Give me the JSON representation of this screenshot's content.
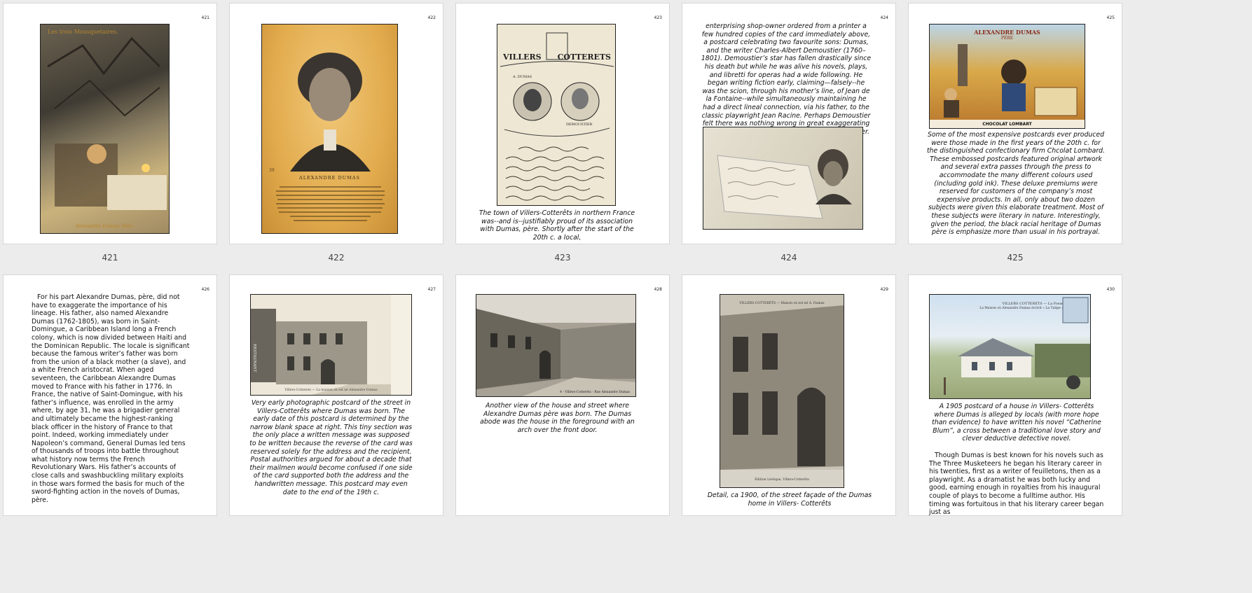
{
  "pages": [
    {
      "num": "421",
      "label": "421",
      "pic": {
        "top_text": "Les trois Mousquetaires.",
        "bottom_text": "Alexandre Dumas Père."
      }
    },
    {
      "num": "422",
      "label": "422",
      "pic": {
        "title": "ALEXANDRE DUMAS",
        "ref": "39"
      }
    },
    {
      "num": "423",
      "label": "423",
      "pic": {
        "title_left": "VILLERS",
        "title_right": "COTTERETS",
        "medallion_left": "A. DUMAS",
        "medallion_right": "DEMOUSTIER"
      },
      "caption": "The town of Villers-Cotterêts in northern France was--and is--justifiably proud of its association with Dumas, père. Shortly after the start of the 20th c. a local,"
    },
    {
      "num": "424",
      "label": "424",
      "body": "enterprising shop-owner ordered from a printer a few hundred copies of the card immediately above, a postcard celebrating two favourite sons: Dumas, and the writer Charles-Albert Demoustier (1760–1801). Demoustier’s star has fallen drastically since his death but while he was alive his novels, plays, and libretti for operas had a wide following. He began writing fiction early, claiming—falsely--he was the scion, through his mother’s line, of Jean de la Fontaine--while simultaneously maintaining he had a direct lineal connection, via his father, to the classic playwright Jean Racine. Perhaps Demoustier felt there was nothing wrong in great exaggerating his claims in this way as he was, after all, a lawyer."
    },
    {
      "num": "425",
      "label": "425",
      "pic": {
        "title": "ALEXANDRE DUMAS",
        "subtitle": "PÈRE",
        "footer": "CHOCOLAT LOMBART"
      },
      "caption": "Some of the most expensive postcards ever produced were those made in the first years of the 20th c. for the distinguished confectionary firm Chcolat Lombard. These embossed postcards featured original artwork and several extra passes through the press to accommodate the many different colours used (including gold ink). These deluxe premiums were reserved for customers of the company’s most expensive products. In all, only about two dozen subjects were given this elaborate treatment. Most of these subjects were literary in nature. Interestingly, given the period, the black racial heritage of Dumas père is emphasize more than usual in his portrayal."
    },
    {
      "num": "426",
      "label": "",
      "body": "For his part Alexandre Dumas, père, did not have to exaggerate the importance of his lineage. His father, also named Alexandre Dumas (1762-1805), was born in Saint-Domingue, a Caribbean Island long a French colony, which is now divided between Haiti and the Dominican Republic. The locale is significant because the famous writer’s father was born from the union of a black mother (a slave), and a white French aristocrat. When aged seventeen, the Caribbean Alexandre Dumas moved to France with his father in 1776. In France, the native of Saint-Domingue, with his father’s influence, was enrolled in the army where, by age 31, he was a brigadier general and ultimately became the highest-ranking black officer in the history of France to that point. Indeed, working immediately under Napoleon’s command, General Dumas led tens of thousands of troops into battle throughout what history now terms the French Revolutionary Wars. His father’s accounts of close calls and swashbuckling military exploits in those wars formed the basis for much of the sword-fighting action in the novels of Dumas, père."
    },
    {
      "num": "427",
      "label": "",
      "pic": {
        "sign": "RESTAURANT",
        "footer": "Villers-Cotterets — La maison où est né Alexandre Dumas"
      },
      "caption": "Very early photographic postcard of the street in Villers-Cotterêts where Dumas was born. The early date of this postcard is determined by the narrow blank space at right. This tiny section was the only place a written message was supposed to be written because the reverse of the card was reserved solely for the address and the recipient. Postal authorities argued for about a decade that their mailmen would become confused if one side of the card supported both the address and the handwritten message. This postcard may even date to the end of the 19th c."
    },
    {
      "num": "428",
      "label": "",
      "pic": {
        "footer": "4 - Villers-Cotterêts - Rue Alexandre Dumas"
      },
      "caption": "Another view of the house and street where Alexandre Dumas père was born. The Dumas abode was the house in the foreground with an arch over the front door."
    },
    {
      "num": "429",
      "label": "",
      "pic": {
        "header": "VILLERS-COTTERÊTS — Maison où est né A. Dumas",
        "footer": "Édition Lévêque, Villers-Cotterêts"
      },
      "caption": "Detail, ca 1900, of the street façade of the Dumas home in Villers- Cotterêts"
    },
    {
      "num": "430",
      "label": "",
      "pic": {
        "header": "VILLERS COTTERETS — La Fosse",
        "subheader": "La Maison où Alexandre Dumas écrivit « La Tulipe »"
      },
      "caption": "A 1905 postcard of a house in Villers- Cotterêts where Dumas is alleged by locals (with more hope than evidence) to have written his novel “Catherine Blum”, a cross between a traditional love story and clever deductive detective novel.",
      "body": "Though Dumas is best known for his novels such as The Three Musketeers he began his literary career in his twenties, first as a writer of feuilletons, then as a playwright. As a dramatist he was both lucky and good, earning enough in royalties from his inaugural couple of plays to become a fulltime author. His timing was fortuitous in that his literary career began just as"
    }
  ]
}
